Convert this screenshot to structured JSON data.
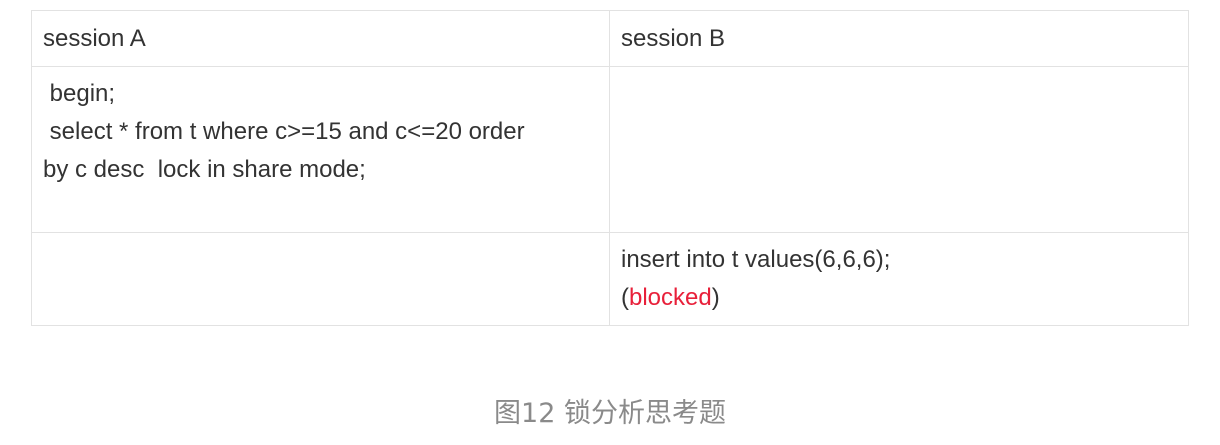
{
  "table": {
    "headers": [
      "session A",
      "session B"
    ],
    "rows": [
      {
        "a": [
          " begin;",
          " select * from t where c>=15 and c<=20 order",
          "by c desc  lock in share mode;"
        ],
        "b": []
      },
      {
        "a": [],
        "b_line1": "insert into t values(6,6,6);",
        "b_paren_open": "(",
        "b_status": "blocked",
        "b_paren_close": ")"
      }
    ]
  },
  "caption": "图12 锁分析思考题",
  "colors": {
    "border": "#e2e2e2",
    "text": "#333333",
    "blocked": "#e8203a",
    "caption": "#8a8a8a"
  }
}
